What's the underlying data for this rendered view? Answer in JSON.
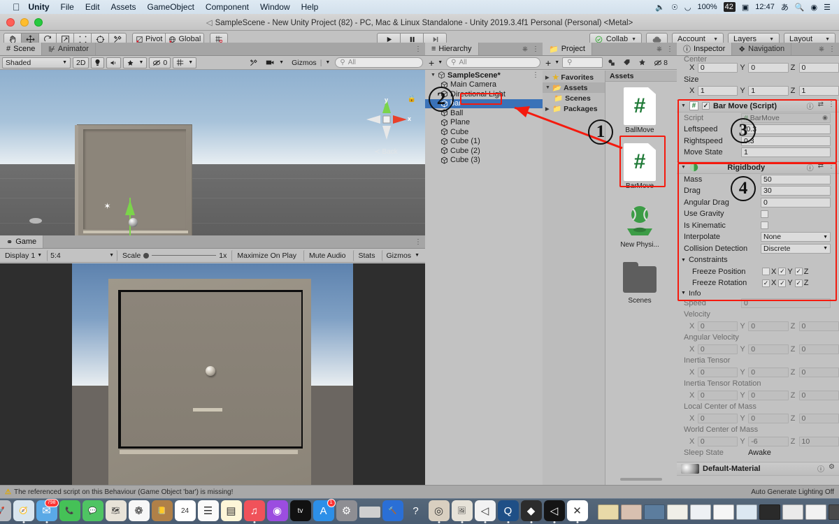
{
  "macbar": {
    "apple_icon": "apple-icon",
    "menus": [
      "Unity",
      "File",
      "Edit",
      "Assets",
      "GameObject",
      "Component",
      "Window",
      "Help"
    ],
    "status": {
      "volume_icon": "volume-icon",
      "podcast_icon": "podcast-icon",
      "wifi_icon": "wifi-icon",
      "battery_pct": "100%",
      "battery_icon": "battery-icon",
      "battery_label": "42",
      "calendar_icon": "calendar-icon",
      "clock": "12:47",
      "input_source": "あ",
      "search_icon": "search-icon",
      "siri_icon": "siri-icon",
      "controlcenter_icon": "control-center-icon"
    }
  },
  "window": {
    "back_icon": "back-arrow-icon",
    "title": "SampleScene - New Unity Project (82) - PC, Mac & Linux Standalone - Unity 2019.3.4f1 Personal (Personal) <Metal>"
  },
  "toolbar": {
    "tools": [
      {
        "name": "hand-tool",
        "icon": "hand-icon",
        "active": false
      },
      {
        "name": "move-tool",
        "icon": "move-icon",
        "active": true
      },
      {
        "name": "rotate-tool",
        "icon": "rotate-icon",
        "active": false
      },
      {
        "name": "scale-tool",
        "icon": "scale-icon",
        "active": false
      },
      {
        "name": "rect-tool",
        "icon": "rect-icon",
        "active": false
      },
      {
        "name": "transform-tool",
        "icon": "transform-icon",
        "active": false
      },
      {
        "name": "custom-tool",
        "icon": "wrench-icon",
        "active": false
      }
    ],
    "pivot_label": "Pivot",
    "global_label": "Global",
    "grid_icon": "grid-snap-icon",
    "play_icon": "play-icon",
    "pause_icon": "pause-icon",
    "step_icon": "step-icon",
    "collab_label": "Collab",
    "cloud_icon": "cloud-icon",
    "account_label": "Account",
    "layers_label": "Layers",
    "layout_label": "Layout"
  },
  "scene_panel": {
    "tabs": [
      {
        "label": "Scene",
        "icon": "scene-icon",
        "active": true
      },
      {
        "label": "Animator",
        "icon": "animator-icon",
        "active": false
      }
    ],
    "lock_icon": "lock-icon",
    "menu_icon": "kebab-menu-icon",
    "shading_mode": "Shaded",
    "mode_2d": "2D",
    "light_icon": "lighting-icon",
    "audio_icon": "audio-icon",
    "fx_icon": "effects-icon",
    "hidden_count": "0",
    "hidden_icon": "hidden-objects-icon",
    "grid_icon": "scene-grid-icon",
    "tools_icon": "scene-tools-icon",
    "camera_icon": "scene-camera-icon",
    "gizmos_label": "Gizmos",
    "search_placeholder": "All",
    "gizmo": {
      "x_label": "x",
      "y_label": "y",
      "view_label": "Back",
      "lock_icon": "persp-lock-icon"
    }
  },
  "game_panel": {
    "tab_label": "Game",
    "tab_icon": "game-icon",
    "menu_icon": "kebab-menu-icon",
    "display": "Display 1",
    "aspect": "5:4",
    "scale_label": "Scale",
    "scale_value": "1x",
    "maximize_label": "Maximize On Play",
    "mute_label": "Mute Audio",
    "stats_label": "Stats",
    "gizmos_label": "Gizmos"
  },
  "hierarchy": {
    "tab_label": "Hierarchy",
    "tab_icon": "hierarchy-icon",
    "lock_icon": "lock-icon",
    "menu_icon": "kebab-menu-icon",
    "add_label": "+",
    "search_placeholder": "All",
    "scene_name": "SampleScene*",
    "scene_icon": "unity-scene-icon",
    "items": [
      {
        "label": "Main Camera",
        "selected": false
      },
      {
        "label": "Directional Light",
        "selected": false
      },
      {
        "label": "bar",
        "selected": true
      },
      {
        "label": "Ball",
        "selected": false
      },
      {
        "label": "Plane",
        "selected": false
      },
      {
        "label": "Cube",
        "selected": false
      },
      {
        "label": "Cube (1)",
        "selected": false
      },
      {
        "label": "Cube (2)",
        "selected": false
      },
      {
        "label": "Cube (3)",
        "selected": false
      }
    ]
  },
  "project": {
    "tab_label": "Project",
    "tab_icon": "folder-icon",
    "lock_icon": "lock-icon",
    "menu_icon": "kebab-menu-icon",
    "add_label": "+",
    "search_placeholder": "",
    "hidden_count": "8",
    "tree": [
      {
        "label": "Favorites",
        "icon": "star-icon",
        "expanded": false,
        "sub": false
      },
      {
        "label": "Assets",
        "icon": "open-folder-icon",
        "expanded": true,
        "sub": false
      },
      {
        "label": "Scenes",
        "icon": "folder-icon",
        "expanded": null,
        "sub": true
      },
      {
        "label": "Packages",
        "icon": "folder-icon",
        "expanded": false,
        "sub": false
      }
    ],
    "breadcrumb": "Assets",
    "assets": [
      {
        "label": "BallMove",
        "kind": "csharp-script",
        "highlighted": false
      },
      {
        "label": "BarMove",
        "kind": "csharp-script",
        "highlighted": true
      },
      {
        "label": "New Physi...",
        "kind": "physic-material",
        "highlighted": false
      },
      {
        "label": "Scenes",
        "kind": "folder",
        "highlighted": false
      }
    ]
  },
  "inspector": {
    "tabs": [
      {
        "label": "Inspector",
        "icon": "info-icon",
        "active": true
      },
      {
        "label": "Navigation",
        "icon": "navigation-icon",
        "active": false
      }
    ],
    "lock_icon": "lock-icon",
    "menu_icon": "kebab-menu-icon",
    "collider_partial": {
      "center_label": "Center",
      "center": {
        "x": "0",
        "y": "0",
        "z": "0"
      },
      "size_label": "Size",
      "size": {
        "x": "1",
        "y": "1",
        "z": "1"
      }
    },
    "bar_move": {
      "title": "Bar Move (Script)",
      "icon": "csharp-script-icon",
      "enabled": true,
      "help_icon": "help-icon",
      "preset_icon": "preset-icon",
      "menu_icon": "kebab-menu-icon",
      "fields": [
        {
          "label": "Script",
          "value": "BarMove",
          "type": "object",
          "readonly": true
        },
        {
          "label": "Leftspeed",
          "value": "-0.3",
          "type": "text",
          "readonly": false
        },
        {
          "label": "Rightspeed",
          "value": "0.3",
          "type": "text",
          "readonly": false
        },
        {
          "label": "Move State",
          "value": "1",
          "type": "text",
          "readonly": false
        }
      ]
    },
    "rigidbody": {
      "title": "Rigidbody",
      "icon": "rigidbody-icon",
      "help_icon": "help-icon",
      "preset_icon": "preset-icon",
      "menu_icon": "kebab-menu-icon",
      "mass_label": "Mass",
      "mass": "50",
      "drag_label": "Drag",
      "drag": "30",
      "angular_drag_label": "Angular Drag",
      "angular_drag": "0",
      "use_gravity_label": "Use Gravity",
      "use_gravity": false,
      "is_kinematic_label": "Is Kinematic",
      "is_kinematic": false,
      "interpolate_label": "Interpolate",
      "interpolate": "None",
      "collision_detection_label": "Collision Detection",
      "collision_detection": "Discrete",
      "constraints_label": "Constraints",
      "freeze_position_label": "Freeze Position",
      "freeze_position": {
        "x": false,
        "y": true,
        "z": true
      },
      "freeze_rotation_label": "Freeze Rotation",
      "freeze_rotation": {
        "x": true,
        "y": true,
        "z": true
      },
      "axis_labels": {
        "x": "X",
        "y": "Y",
        "z": "Z"
      },
      "info_label": "Info",
      "info": {
        "speed_label": "Speed",
        "speed": "0",
        "velocity_label": "Velocity",
        "velocity": {
          "x": "0",
          "y": "0",
          "z": "0"
        },
        "angular_velocity_label": "Angular Velocity",
        "angular_velocity": {
          "x": "0",
          "y": "0",
          "z": "0"
        },
        "inertia_tensor_label": "Inertia Tensor",
        "inertia_tensor": {
          "x": "0",
          "y": "0",
          "z": "0"
        },
        "inertia_tensor_rotation_label": "Inertia Tensor Rotation",
        "inertia_tensor_rotation": {
          "x": "0",
          "y": "0",
          "z": "0"
        },
        "local_center_of_mass_label": "Local Center of Mass",
        "local_center_of_mass": {
          "x": "0",
          "y": "0",
          "z": "0"
        },
        "world_center_of_mass_label": "World Center of Mass",
        "world_center_of_mass": {
          "x": "0",
          "y": "-6",
          "z": "10"
        },
        "sleep_state_label": "Sleep State",
        "sleep_state": "Awake"
      }
    },
    "material": {
      "name": "Default-Material",
      "help_icon": "help-icon",
      "gear_icon": "gear-icon"
    }
  },
  "annotations": {
    "markers": [
      "1",
      "2",
      "3",
      "4"
    ],
    "highlight_color": "#f51a0e"
  },
  "statusbar": {
    "warn_icon": "warning-icon",
    "message": "The referenced script on this Behaviour (Game Object 'bar') is missing!",
    "lighting": "Auto Generate Lighting Off"
  },
  "dock": {
    "apps": [
      {
        "name": "finder",
        "color": "#3aa0e0",
        "glyph": "☺",
        "running": true,
        "badge": null
      },
      {
        "name": "launchpad",
        "color": "#b8bcc2",
        "glyph": "🚀",
        "running": false,
        "badge": null
      },
      {
        "name": "safari",
        "color": "#d9e6ef",
        "glyph": "🧭",
        "running": true,
        "badge": null
      },
      {
        "name": "mail",
        "color": "#5aa9e6",
        "glyph": "✉",
        "running": true,
        "badge": "798"
      },
      {
        "name": "facetime",
        "color": "#45c157",
        "glyph": "📞",
        "running": false,
        "badge": null
      },
      {
        "name": "messages",
        "color": "#4fc463",
        "glyph": "💬",
        "running": false,
        "badge": null
      },
      {
        "name": "maps",
        "color": "#e8e3d8",
        "glyph": "🗺",
        "running": false,
        "badge": null
      },
      {
        "name": "photos",
        "color": "#f7f7f7",
        "glyph": "❁",
        "running": false,
        "badge": null
      },
      {
        "name": "contacts",
        "color": "#b08048",
        "glyph": "📒",
        "running": false,
        "badge": null
      },
      {
        "name": "calendar",
        "color": "#ffffff",
        "glyph": "24",
        "running": false,
        "badge": null
      },
      {
        "name": "reminders",
        "color": "#fafafa",
        "glyph": "☰",
        "running": false,
        "badge": null
      },
      {
        "name": "notes",
        "color": "#fdf6d8",
        "glyph": "▤",
        "running": false,
        "badge": null
      },
      {
        "name": "music",
        "color": "#f0525a",
        "glyph": "♫",
        "running": true,
        "badge": null
      },
      {
        "name": "podcasts",
        "color": "#9b4de0",
        "glyph": "◉",
        "running": false,
        "badge": null
      },
      {
        "name": "appletv",
        "color": "#111111",
        "glyph": "tv",
        "running": false,
        "badge": null
      },
      {
        "name": "appstore",
        "color": "#2c8fe8",
        "glyph": "A",
        "running": false,
        "badge": "1"
      },
      {
        "name": "system-preferences",
        "color": "#8e8e93",
        "glyph": "⚙",
        "running": false,
        "badge": null
      },
      {
        "name": "minimized-window",
        "color": "#cfcfcf",
        "glyph": "",
        "running": false,
        "badge": null
      },
      {
        "name": "xcode",
        "color": "#2a6fd6",
        "glyph": "🔨",
        "running": false,
        "badge": null
      },
      {
        "name": "help",
        "color": "transparent",
        "glyph": "?",
        "running": false,
        "badge": null
      },
      {
        "name": "unity-hub",
        "color": "#d9cfc0",
        "glyph": "◎",
        "running": true,
        "badge": null
      },
      {
        "name": "preview",
        "color": "#e6e2d8",
        "glyph": "🖼",
        "running": true,
        "badge": null
      },
      {
        "name": "unity-white",
        "color": "#f2f2f2",
        "glyph": "◁",
        "running": true,
        "badge": null
      },
      {
        "name": "qlab",
        "color": "#1f4f86",
        "glyph": "Q",
        "running": true,
        "badge": null
      },
      {
        "name": "sketch",
        "color": "#2c2c2c",
        "glyph": "◆",
        "running": true,
        "badge": null
      },
      {
        "name": "unity-dark",
        "color": "#141414",
        "glyph": "◁",
        "running": true,
        "badge": null
      },
      {
        "name": "visual-studio-code",
        "color": "#ffffff",
        "glyph": "✕",
        "running": true,
        "badge": null
      }
    ],
    "minimized": [
      {
        "name": "window-thumb-1",
        "color": "#e8d9a8"
      },
      {
        "name": "window-thumb-2",
        "color": "#d8c0b0"
      },
      {
        "name": "window-thumb-3",
        "color": "#5c7d9e"
      },
      {
        "name": "window-thumb-4",
        "color": "#f0efe8"
      },
      {
        "name": "window-thumb-5",
        "color": "#eef1f4"
      },
      {
        "name": "window-thumb-6",
        "color": "#f6f6f6"
      },
      {
        "name": "window-thumb-7",
        "color": "#dce8f2"
      },
      {
        "name": "window-thumb-8",
        "color": "#2a2a2a"
      },
      {
        "name": "window-thumb-9",
        "color": "#eaeaea"
      },
      {
        "name": "window-thumb-10",
        "color": "#f2f2f2"
      },
      {
        "name": "window-thumb-11",
        "color": "#4a4a4a"
      }
    ],
    "trash_icon": "trash-icon"
  }
}
